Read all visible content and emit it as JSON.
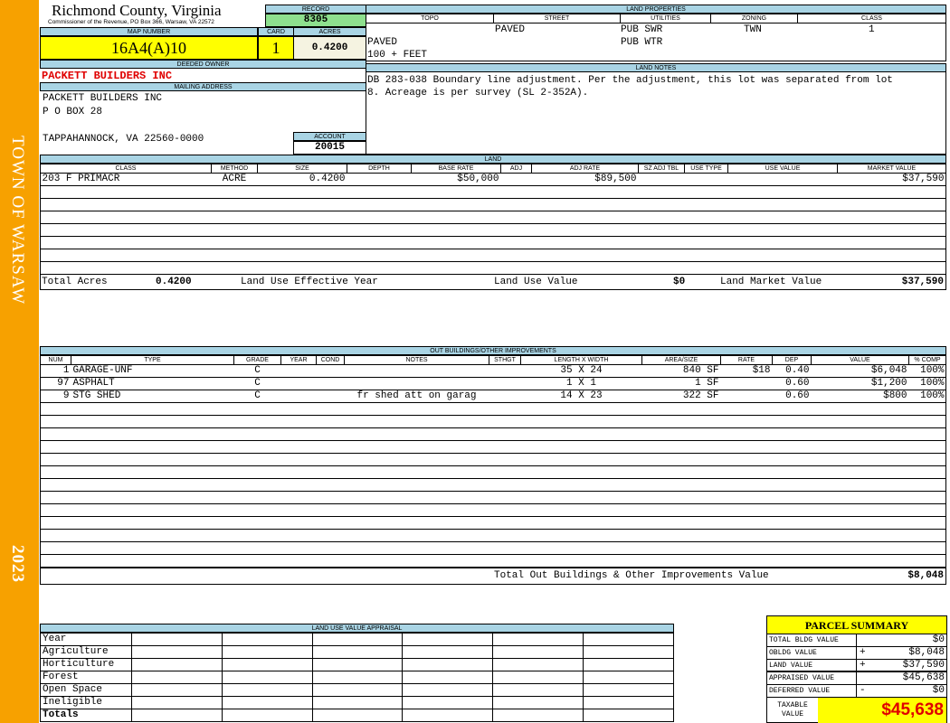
{
  "sidebar": {
    "town": "TOWN OF WARSAW",
    "year": "2023"
  },
  "header": {
    "county": "Richmond County, Virginia",
    "subtitle": "Commissioner of the Revenue, PO Box 366, Warsaw, VA 22572",
    "record_label": "RECORD",
    "record": "8305"
  },
  "parcel": {
    "map_label": "MAP NUMBER",
    "map": "16A4(A)10",
    "card_label": "CARD",
    "card": "1",
    "acres_label": "ACRES",
    "acres": "0.4200"
  },
  "owner": {
    "deeded_label": "DEEDED OWNER",
    "deeded": "PACKETT BUILDERS INC",
    "mailing_label": "MAILING ADDRESS",
    "line1": "PACKETT BUILDERS INC",
    "line2": "P O BOX 28",
    "line3": "TAPPAHANNOCK, VA 22560-0000",
    "account_label": "ACCOUNT",
    "account": "20015"
  },
  "land_properties": {
    "title": "LAND PROPERTIES",
    "headers": [
      "TOPO",
      "STREET",
      "UTILITIES",
      "ZONING",
      "CLASS"
    ],
    "street": "PAVED",
    "utilities1": "PUB SWR",
    "utilities2": "PUB WTR",
    "zoning": "TWN",
    "class": "1",
    "line2": "PAVED",
    "line3": "100 + FEET"
  },
  "land_notes": {
    "title": "LAND NOTES",
    "text": "DB 283-038 Boundary line adjustment. Per the adjustment, this lot was separated from lot 8. Acreage is per survey (SL 2-352A)."
  },
  "land": {
    "title": "LAND",
    "headers": [
      "CLASS",
      "METHOD",
      "SIZE",
      "DEPTH",
      "BASE RATE",
      "ADJ",
      "ADJ RATE",
      "SZ ADJ TBL",
      "USE TYPE",
      "USE VALUE",
      "MARKET VALUE"
    ],
    "rows": [
      [
        "203 F PRIMACR",
        "ACRE",
        "0.4200",
        "",
        "$50,000",
        "",
        "$89,500",
        "",
        "",
        "",
        "$37,590"
      ]
    ],
    "total_acres_label": "Total Acres",
    "total_acres": "0.4200",
    "effective_year_label": "Land Use Effective Year",
    "use_value_label": "Land Use Value",
    "use_value": "$0",
    "market_value_label": "Land Market Value",
    "market_value": "$37,590"
  },
  "outbuildings": {
    "title": "OUT BUILDINGS/OTHER IMPROVEMENTS",
    "headers": [
      "NUM",
      "TYPE",
      "GRADE",
      "YEAR",
      "COND",
      "NOTES",
      "STHGT",
      "LENGTH X WIDTH",
      "AREA/SIZE",
      "RATE",
      "DEP",
      "VALUE",
      "% COMP"
    ],
    "rows": [
      [
        "1",
        "GARAGE-UNF",
        "C",
        "",
        "",
        "",
        "",
        "35 X 24",
        "840 SF",
        "$18",
        "0.40",
        "$6,048",
        "100%"
      ],
      [
        "97",
        "ASPHALT",
        "C",
        "",
        "",
        "",
        "",
        "1 X 1",
        "1 SF",
        "",
        "0.60",
        "$1,200",
        "100%"
      ],
      [
        "9",
        "STG SHED",
        "C",
        "",
        "",
        "fr shed att on garag",
        "",
        "14 X 23",
        "322 SF",
        "",
        "0.60",
        "$800",
        "100%"
      ]
    ],
    "total_label": "Total Out Buildings & Other Improvements Value",
    "total": "$8,048"
  },
  "land_use": {
    "title": "LAND USE VALUE APPRAISAL",
    "rows": [
      "Year",
      "Agriculture",
      "Horticulture",
      "Forest",
      "Open Space",
      "Ineligible",
      "Totals"
    ]
  },
  "summary": {
    "title": "PARCEL SUMMARY",
    "rows": [
      {
        "label": "TOTAL BLDG VALUE",
        "op": "",
        "value": "$0"
      },
      {
        "label": "OBLDG VALUE",
        "op": "+",
        "value": "$8,048"
      },
      {
        "label": "LAND VALUE",
        "op": "+",
        "value": "$37,590"
      },
      {
        "label": "APPRAISED VALUE",
        "op": "",
        "value": "$45,638"
      },
      {
        "label": "DEFERRED VALUE",
        "op": "-",
        "value": "$0"
      }
    ],
    "taxable_label": "TAXABLE VALUE",
    "taxable": "$45,638"
  },
  "colors": {
    "sidebar": "#f7a100",
    "header_band": "#a9d4e4",
    "highlight": "#ffff00",
    "record": "#8ee08e",
    "owner": "#e00000"
  }
}
